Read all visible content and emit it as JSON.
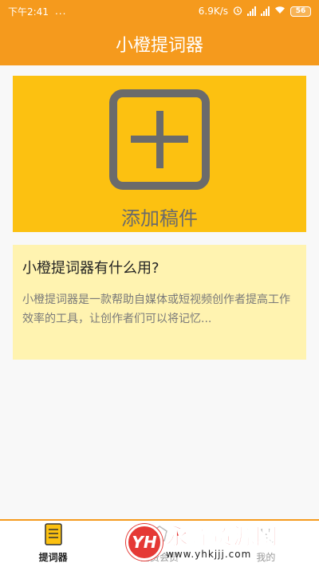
{
  "status_bar": {
    "time": "下午2:41",
    "dots": "...",
    "speed": "6.9K/s",
    "battery": "56"
  },
  "header": {
    "title": "小橙提词器"
  },
  "add_card": {
    "label": "添加稿件",
    "icon": "plus-square-icon"
  },
  "info_card": {
    "title": "小橙提词器有什么用?",
    "body": "小橙提词器是一款帮助自媒体或短视频创作者提高工作效率的工具，让创作者们可以将记忆..."
  },
  "bottom_nav": {
    "items": [
      {
        "label": "提词器",
        "icon": "document-icon",
        "active": true
      },
      {
        "label": "免费会员",
        "icon": "vip-icon",
        "active": false
      },
      {
        "label": "我的",
        "icon": "user-icon",
        "active": false
      }
    ]
  },
  "watermark": {
    "logo": "YH",
    "name": "永辉资源网",
    "url": "www.yhkjjj.com"
  },
  "colors": {
    "accent": "#f59a1d",
    "card_yellow": "#fcc111",
    "info_bg": "#fff3b0"
  }
}
